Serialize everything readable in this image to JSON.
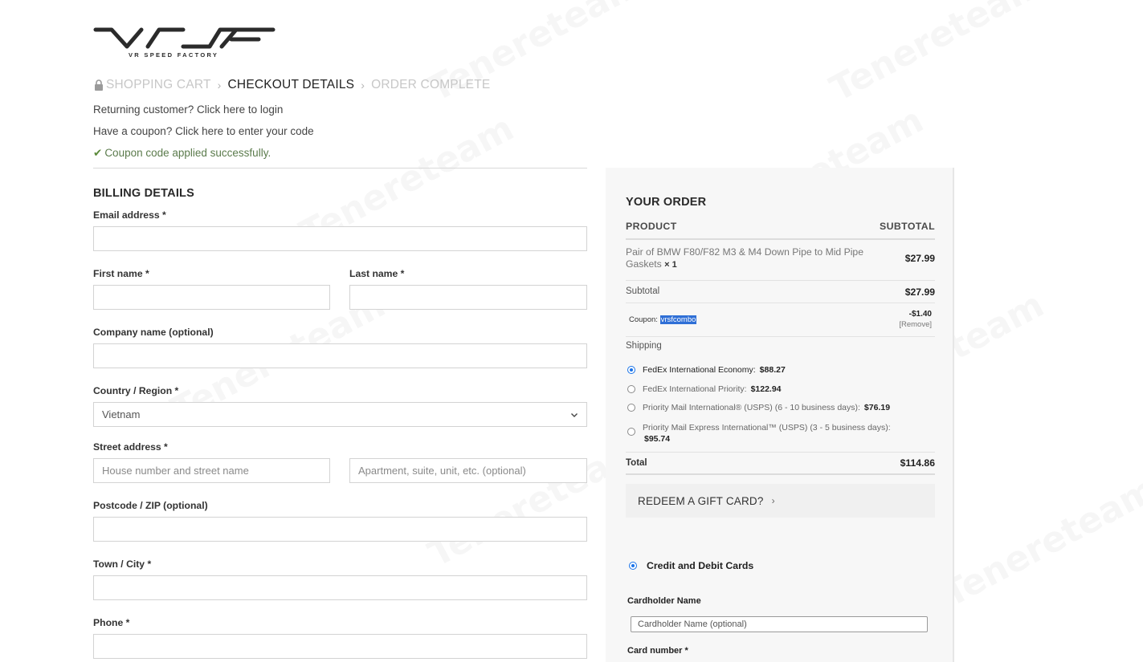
{
  "brand": {
    "logo_sub": "VR SPEED FACTORY"
  },
  "steps": [
    "SHOPPING CART",
    "CHECKOUT DETAILS",
    "ORDER COMPLETE"
  ],
  "notices": {
    "returning": "Returning customer? Click here to login",
    "coupon": "Have a coupon? Click here to enter your code",
    "applied": "Coupon code applied successfully."
  },
  "billing": {
    "title": "BILLING DETAILS",
    "email_label": "Email address *",
    "first_label": "First name *",
    "last_label": "Last name *",
    "company_label": "Company name (optional)",
    "country_label": "Country / Region *",
    "country_value": "Vietnam",
    "street_label": "Street address *",
    "street_placeholder": "House number and street name",
    "apt_placeholder": "Apartment, suite, unit, etc. (optional)",
    "zip_label": "Postcode / ZIP (optional)",
    "city_label": "Town / City *",
    "phone_label": "Phone *"
  },
  "order": {
    "title": "YOUR ORDER",
    "col_product": "PRODUCT",
    "col_subtotal": "SUBTOTAL",
    "item_name": "Pair of BMW F80/F82 M3 & M4 Down Pipe to Mid Pipe Gaskets",
    "item_qty": "× 1",
    "item_price": "$27.99",
    "subtotal_label": "Subtotal",
    "subtotal_value": "$27.99",
    "coupon_prefix": "Coupon:",
    "coupon_code": "vrsfcombo",
    "coupon_amount": "-$1.40",
    "coupon_remove": "[Remove]",
    "shipping_label": "Shipping",
    "shipping_options": [
      {
        "name": "FedEx International Economy:",
        "price": "$88.27",
        "selected": true
      },
      {
        "name": "FedEx International Priority:",
        "price": "$122.94",
        "selected": false
      },
      {
        "name": "Priority Mail International® (USPS) (6 - 10 business days):",
        "price": "$76.19",
        "selected": false
      },
      {
        "name": "Priority Mail Express International™ (USPS) (3 - 5 business days):",
        "price": "$95.74",
        "selected": false
      }
    ],
    "total_label": "Total",
    "total_value": "$114.86",
    "gift_label": "REDEEM A GIFT CARD?"
  },
  "payment": {
    "method": "Credit and Debit Cards",
    "cardholder_label": "Cardholder Name",
    "cardholder_placeholder": "Cardholder Name (optional)",
    "card_number_label": "Card number *"
  },
  "watermark": "Tenereteam"
}
